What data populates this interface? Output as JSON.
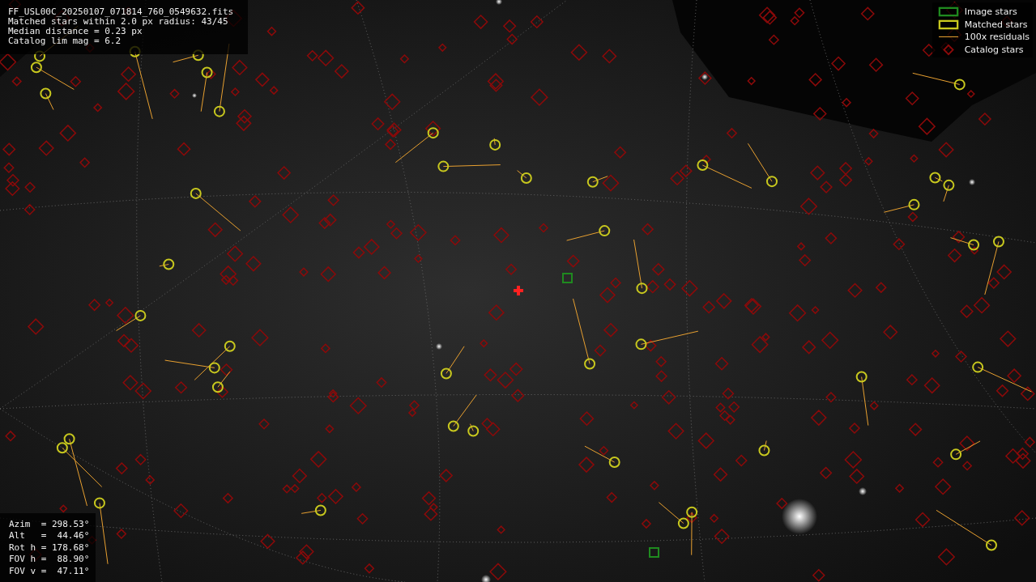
{
  "info": {
    "lines": [
      "FF_USL00C_20250107_071814_760_0549632.fits",
      "Matched stars within 2.0 px radius: 43/45",
      "Median distance = 0.23 px",
      "Catalog lim mag = 6.2"
    ]
  },
  "legend": [
    {
      "label": "Image stars",
      "color": "#1f8a1f"
    },
    {
      "kind": "matched",
      "label": "Matched stars",
      "color": "#c8c81e"
    },
    {
      "kind": "residual",
      "label": "100x residuals",
      "color": "#e8a030"
    },
    {
      "kind": "catalog",
      "label": "Catalog stars",
      "color": "#8b0a0a"
    }
  ],
  "pointing": {
    "lines": [
      "Azim  = 298.53°",
      "Alt   =  44.46°",
      "Rot h = 178.68°",
      "FOV h =  88.90°",
      "FOV v =  47.11°"
    ]
  }
}
